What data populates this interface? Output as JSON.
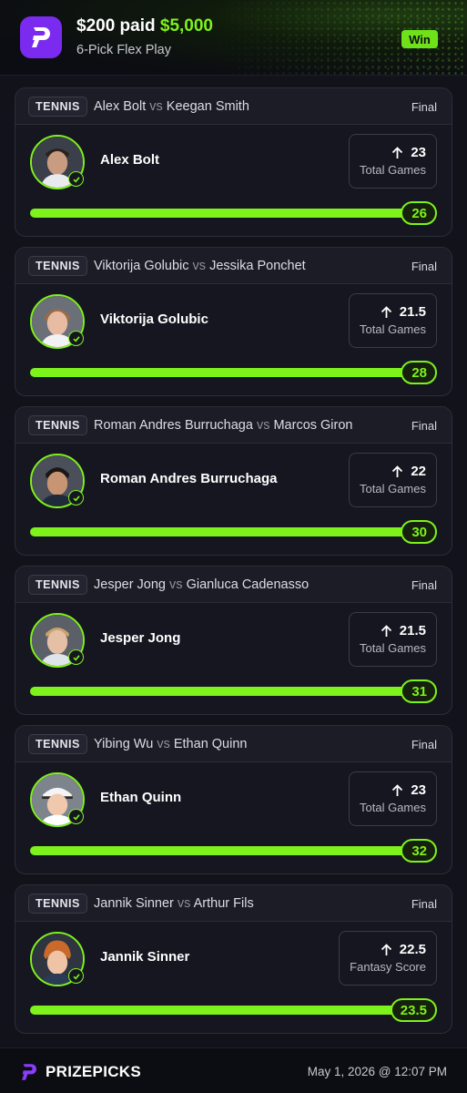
{
  "header": {
    "amount_paid": "$200 paid",
    "payout": "$5,000",
    "subtitle": "6-Pick Flex Play",
    "result_badge": "Win",
    "logo_icon": "prizepicks-logo-icon",
    "accent_color": "#7ef21b",
    "logo_color": "#7b2bf0"
  },
  "picks": [
    {
      "sport": "TENNIS",
      "player_a": "Alex Bolt",
      "vs": "vs",
      "player_b": "Keegan Smith",
      "status": "Final",
      "player": "Alex Bolt",
      "line": "23",
      "stat": "Total Games",
      "direction": "more-arrow-up-icon",
      "result": "26",
      "progress": 1.0
    },
    {
      "sport": "TENNIS",
      "player_a": "Viktorija Golubic",
      "vs": "vs",
      "player_b": "Jessika Ponchet",
      "status": "Final",
      "player": "Viktorija Golubic",
      "line": "21.5",
      "stat": "Total Games",
      "direction": "more-arrow-up-icon",
      "result": "28",
      "progress": 1.0
    },
    {
      "sport": "TENNIS",
      "player_a": "Roman Andres Burruchaga",
      "vs": "vs",
      "player_b": "Marcos Giron",
      "status": "Final",
      "player": "Roman Andres Burruchaga",
      "line": "22",
      "stat": "Total Games",
      "direction": "more-arrow-up-icon",
      "result": "30",
      "progress": 1.0
    },
    {
      "sport": "TENNIS",
      "player_a": "Jesper Jong",
      "vs": "vs",
      "player_b": "Gianluca Cadenasso",
      "status": "Final",
      "player": "Jesper Jong",
      "line": "21.5",
      "stat": "Total Games",
      "direction": "more-arrow-up-icon",
      "result": "31",
      "progress": 1.0
    },
    {
      "sport": "TENNIS",
      "player_a": "Yibing Wu",
      "vs": "vs",
      "player_b": "Ethan Quinn",
      "status": "Final",
      "player": "Ethan Quinn",
      "line": "23",
      "stat": "Total Games",
      "direction": "more-arrow-up-icon",
      "result": "32",
      "progress": 1.0
    },
    {
      "sport": "TENNIS",
      "player_a": "Jannik Sinner",
      "vs": "vs",
      "player_b": "Arthur Fils",
      "status": "Final",
      "player": "Jannik Sinner",
      "line": "22.5",
      "stat": "Fantasy Score",
      "direction": "more-arrow-up-icon",
      "result": "23.5",
      "progress": 1.0
    }
  ],
  "footer": {
    "brand": "PRIZEPICKS",
    "timestamp": "May 1, 2026 @ 12:07 PM"
  }
}
